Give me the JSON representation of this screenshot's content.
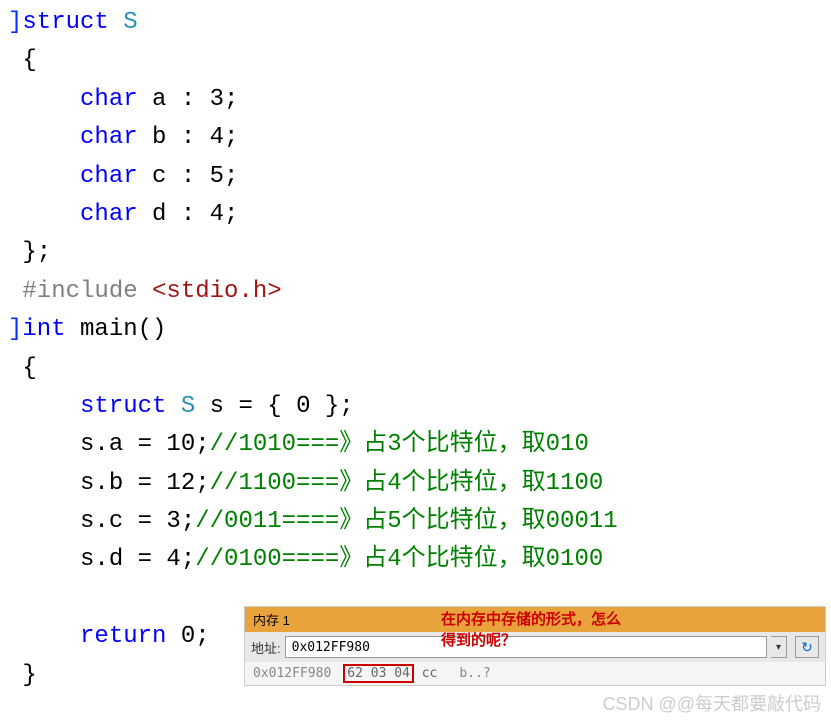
{
  "code": {
    "line1_bracket": "]",
    "line1_struct": "struct",
    "line1_name": "S",
    "line2": " {",
    "line3_char": "char",
    "line3_rest": " a : 3;",
    "line4_char": "char",
    "line4_rest": " b : 4;",
    "line5_char": "char",
    "line5_rest": " c : 5;",
    "line6_char": "char",
    "line6_rest": " d : 4;",
    "line7": " };",
    "line8_pre": "#include",
    "line8_inc": "<stdio.h>",
    "line9_bracket": "]",
    "line9_int": "int",
    "line9_main": " main()",
    "line10": " {",
    "line11_struct": "struct",
    "line11_name": "S",
    "line11_rest": " s = { 0 };",
    "line12a": "     s.a = 10;",
    "line12b": "//1010===》占3个比特位，取010",
    "line13a": "     s.b = 12;",
    "line13b": "//1100===》占4个比特位，取1100",
    "line14a": "     s.c = 3;",
    "line14b": "//0011====》占5个比特位，取00011",
    "line15a": "     s.d = 4;",
    "line15b": "//0100====》占4个比特位，取0100",
    "line16_return": "return",
    "line16_val": " 0;",
    "line17": " }"
  },
  "memory": {
    "title": "内存 1",
    "addr_label": "地址:",
    "addr_value": "0x012FF980",
    "data_addr": "0x012FF980",
    "data_bytes": "62 03 04",
    "data_bytes_after": " cc",
    "data_ascii": "b..?"
  },
  "annotation": {
    "line1": "在内存中存储的形式，怎么",
    "line2": "得到的呢？"
  },
  "watermark": "CSDN @@每天都要敲代码"
}
